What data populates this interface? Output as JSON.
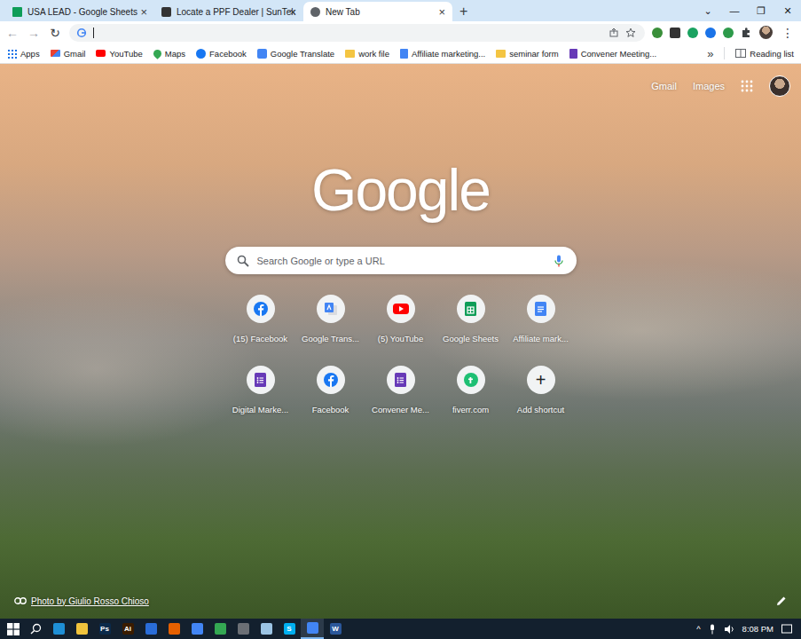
{
  "window": {
    "controls": [
      "⌄",
      "—",
      "❐",
      "✕"
    ]
  },
  "tabs": [
    {
      "label": "USA LEAD - Google Sheets",
      "selected": false,
      "kind": "sheets",
      "close": "×"
    },
    {
      "label": "Locate a PPF Dealer | SunTek",
      "selected": false,
      "kind": "suntek",
      "close": "×"
    },
    {
      "label": "New Tab",
      "selected": true,
      "kind": "newtab",
      "close": "×"
    }
  ],
  "new_tab_button": "+",
  "toolbar": {
    "back": "←",
    "forward": "→",
    "reload": "↻",
    "menu": "⋮"
  },
  "bookmarks": [
    {
      "label": "Apps",
      "kind": "apps"
    },
    {
      "label": "Gmail",
      "kind": "gmail"
    },
    {
      "label": "YouTube",
      "kind": "youtube"
    },
    {
      "label": "Maps",
      "kind": "maps"
    },
    {
      "label": "Facebook",
      "kind": "facebook"
    },
    {
      "label": "Google Translate",
      "kind": "translate"
    },
    {
      "label": "work file",
      "kind": "folder"
    },
    {
      "label": "Affiliate marketing...",
      "kind": "docs"
    },
    {
      "label": "seminar form",
      "kind": "folder"
    },
    {
      "label": "Convener Meeting...",
      "kind": "forms"
    }
  ],
  "bookmarks_overflow": "»",
  "reading_list": "Reading list",
  "header_links": [
    "Gmail",
    "Images"
  ],
  "logo": "Google",
  "search": {
    "placeholder": "Search Google or type a URL"
  },
  "shortcuts": [
    {
      "label": "(15) Facebook",
      "kind": "facebook"
    },
    {
      "label": "Google Trans...",
      "kind": "translate"
    },
    {
      "label": "(5) YouTube",
      "kind": "youtube"
    },
    {
      "label": "Google Sheets",
      "kind": "sheets"
    },
    {
      "label": "Affiliate mark...",
      "kind": "docs"
    },
    {
      "label": "Digital Marke...",
      "kind": "forms"
    },
    {
      "label": "Facebook",
      "kind": "facebook"
    },
    {
      "label": "Convener Me...",
      "kind": "forms"
    },
    {
      "label": "fiverr.com",
      "kind": "fiverr"
    },
    {
      "label": "Add shortcut",
      "kind": "add",
      "glyph": "+"
    }
  ],
  "photo_credit": "Photo by Giulio Rosso Chioso",
  "taskbar": {
    "apps": [
      {
        "glyph": "",
        "color": "#1e8fd6",
        "selected": false
      },
      {
        "glyph": "",
        "color": "#f0c33c",
        "selected": false
      },
      {
        "glyph": "Ps",
        "color": "#0b2a4a",
        "selected": false
      },
      {
        "glyph": "Ai",
        "color": "#3a1c00",
        "selected": false
      },
      {
        "glyph": "",
        "color": "#2a6dd9",
        "selected": false
      },
      {
        "glyph": "",
        "color": "#e66000",
        "selected": false
      },
      {
        "glyph": "",
        "color": "#4285f4",
        "selected": false
      },
      {
        "glyph": "",
        "color": "#34a853",
        "selected": false
      },
      {
        "glyph": "",
        "color": "#6b6f75",
        "selected": false
      },
      {
        "glyph": "",
        "color": "#9cc4e4",
        "selected": false
      },
      {
        "glyph": "S",
        "color": "#00aff0",
        "selected": false
      },
      {
        "glyph": "",
        "color": "#4285f4",
        "selected": true
      },
      {
        "glyph": "W",
        "color": "#2b579a",
        "selected": false
      }
    ],
    "tray_expand": "^",
    "time": "8:08 PM"
  }
}
